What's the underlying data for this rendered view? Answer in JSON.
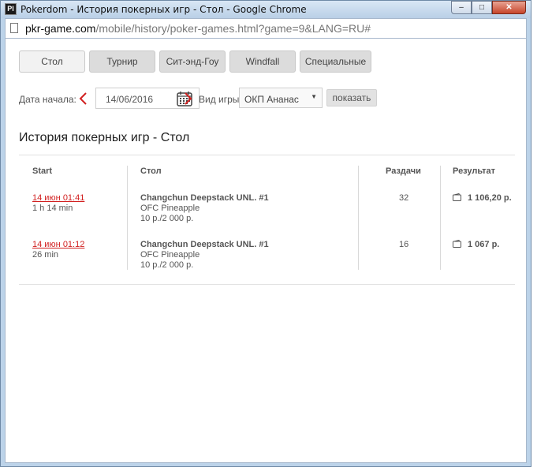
{
  "window": {
    "app_icon": "Pl",
    "title": "Pokerdom - История покерных игр - Стол - Google Chrome",
    "minimize_icon": "–",
    "maximize_icon": "□",
    "close_icon": "✕"
  },
  "address": {
    "domain": "pkr-game.com",
    "path": "/mobile/history/poker-games.html?game=9&LANG=RU#"
  },
  "tabs": [
    {
      "label": "Стол"
    },
    {
      "label": "Турнир"
    },
    {
      "label": "Сит-энд-Гоу"
    },
    {
      "label": "Windfall"
    },
    {
      "label": "Специальные"
    }
  ],
  "filters": {
    "start_date_label": "Дата начала:",
    "start_date_value": "14/06/2016",
    "game_type_label": "Вид игры:",
    "game_type_value": "ОКП Ананас",
    "show_button": "показать"
  },
  "heading": "История покерных игр - Стол",
  "table": {
    "headers": {
      "start": "Start",
      "table": "Стол",
      "hands": "Раздачи",
      "result": "Результат"
    },
    "rows": [
      {
        "start_link": "14 июн 01:41",
        "duration": "1 h 14 min",
        "table_name": "Changchun Deepstack UNL. #1",
        "game": "OFC Pineapple",
        "stakes": "10 р./2 000 р.",
        "hands": "32",
        "result": "1 106,20 р."
      },
      {
        "start_link": "14 июн 01:12",
        "duration": "26 min",
        "table_name": "Changchun Deepstack UNL. #1",
        "game": "OFC Pineapple",
        "stakes": "10 р./2 000 р.",
        "hands": "16",
        "result": "1 067 р."
      }
    ]
  },
  "colors": {
    "accent_red": "#d11f1f",
    "tab_bg": "#dcdcdc",
    "window_frame": "#bcd3e9"
  }
}
